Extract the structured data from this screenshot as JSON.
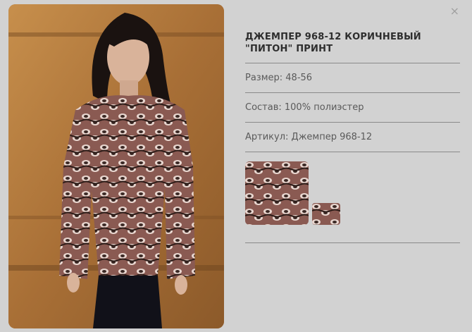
{
  "modal": {
    "close_label": "×"
  },
  "product": {
    "title": "ДЖЕМПЕР 968-12 КОРИЧНЕВЫЙ \"ПИТОН\" ПРИНТ",
    "size": "Размер: 48-56",
    "composition": "Состав: 100% полиэстер",
    "article": "Артикул: Джемпер 968-12"
  },
  "colors": {
    "background": "#d2d2d2",
    "divider": "#8a8a8a",
    "wall": "#b07a3e",
    "print_dark": "#3a2824",
    "print_mid": "#8a5a52",
    "print_light": "#e8d6cf"
  }
}
